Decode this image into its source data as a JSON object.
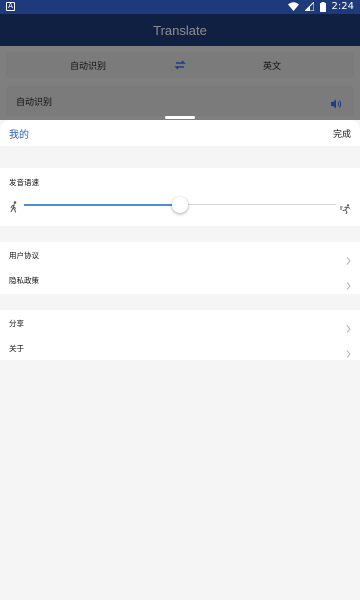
{
  "status_bar": {
    "left_icon_letter": "A",
    "time": "2:24"
  },
  "background_app": {
    "title": "Translate",
    "source_language": "自动识别",
    "target_language": "英文",
    "input_label": "自动识别"
  },
  "sheet": {
    "title": "我的",
    "done_label": "完成",
    "speech_speed": {
      "label": "发音语速",
      "value_fraction": 0.5
    },
    "section_1": [
      {
        "label": "用户协议"
      },
      {
        "label": "隐私政策"
      }
    ],
    "section_2": [
      {
        "label": "分享"
      },
      {
        "label": "关于"
      }
    ]
  },
  "colors": {
    "accent": "#2a5fbf",
    "slider_fill": "#4a90d9",
    "header_bg": "#1e3a7a"
  }
}
